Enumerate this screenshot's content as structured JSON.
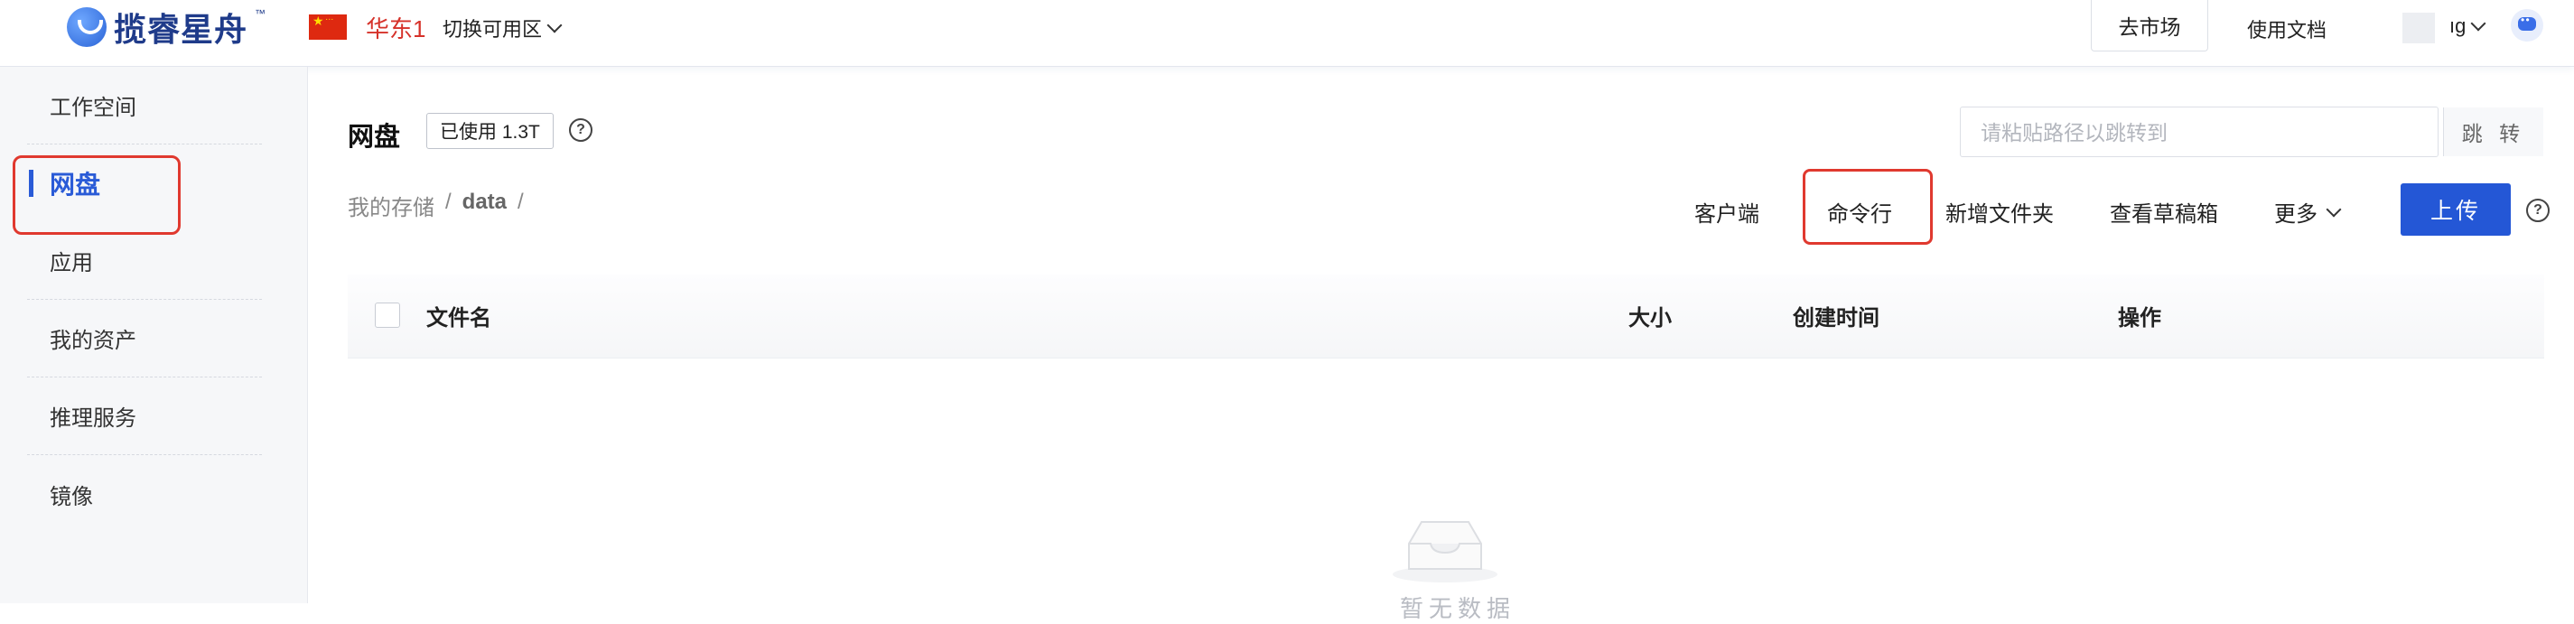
{
  "header": {
    "logo_text": "揽睿星舟",
    "logo_tm": "™",
    "region": "华东1",
    "switch_zone_label": "切换可用区",
    "market_button": "去市场",
    "docs_link": "使用文档",
    "user_name": "ıg"
  },
  "sidebar": {
    "items": [
      {
        "label": "工作空间"
      },
      {
        "label": "网盘",
        "active": true
      },
      {
        "label": "应用"
      },
      {
        "label": "我的资产"
      },
      {
        "label": "推理服务"
      },
      {
        "label": "镜像"
      }
    ]
  },
  "main": {
    "title": "网盘",
    "usage_badge": "已使用 1.3T",
    "path_search": {
      "placeholder": "请粘贴路径以跳转到",
      "value": "",
      "button": "跳 转"
    },
    "breadcrumb": [
      "我的存储",
      "/",
      "data",
      "/"
    ],
    "toolbar": {
      "client": "客户端",
      "command_line": "命令行",
      "new_folder": "新增文件夹",
      "drafts": "查看草稿箱",
      "more": "更多",
      "upload": "上传"
    },
    "table": {
      "columns": [
        "文件名",
        "大小",
        "创建时间",
        "操作"
      ],
      "rows": []
    },
    "empty_text": "暂无数据"
  },
  "colors": {
    "brand_blue": "#2457d6",
    "highlight_red": "#e0392f",
    "region_red": "#d6322a"
  }
}
